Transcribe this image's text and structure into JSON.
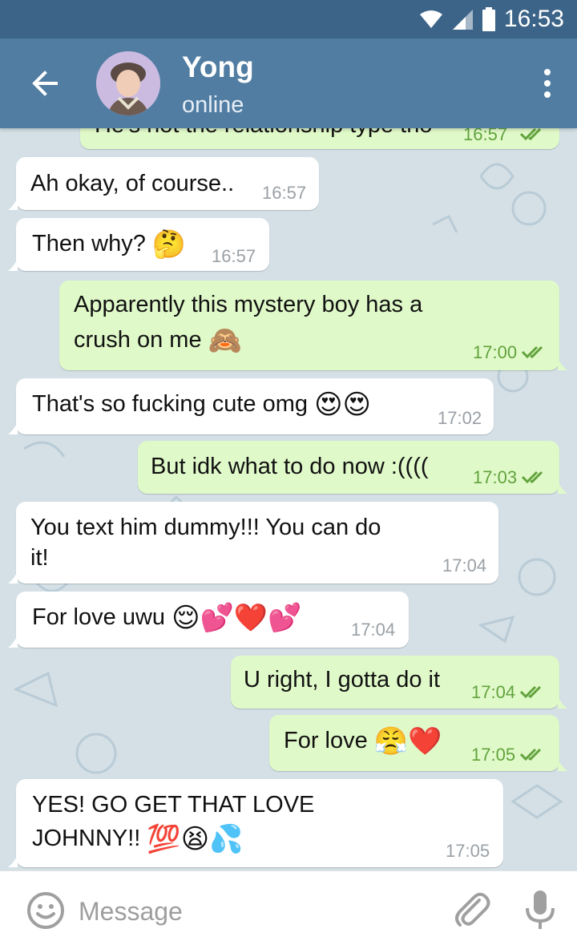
{
  "status_bar": {
    "time": "16:53"
  },
  "header": {
    "contact_name": "Yong",
    "contact_status": "online"
  },
  "messages": [
    {
      "dir": "out",
      "text": "He's not the relationship type tho",
      "time": "16:57",
      "read": true
    },
    {
      "dir": "in",
      "text": "Ah okay, of course..",
      "time": "16:57"
    },
    {
      "dir": "in",
      "text": "Then why?",
      "emoji": "🤔",
      "time": "16:57"
    },
    {
      "dir": "out",
      "line1": "Apparently this mystery boy has a",
      "line2": "crush on me",
      "emoji": "🙈",
      "time": "17:00",
      "read": true
    },
    {
      "dir": "in",
      "text": "That's so fucking cute omg",
      "emoji": "😍😍",
      "time": "17:02"
    },
    {
      "dir": "out",
      "text": "But idk what to do now :((((",
      "time": "17:03",
      "read": true
    },
    {
      "dir": "in",
      "line1": "You text him dummy!!! You can do",
      "line2": "it!",
      "time": "17:04"
    },
    {
      "dir": "in",
      "text": "For love uwu",
      "emoji": "😌💕❤️💕",
      "time": "17:04"
    },
    {
      "dir": "out",
      "text": "U right, I gotta do it",
      "time": "17:04",
      "read": true
    },
    {
      "dir": "out",
      "text": "For love",
      "emoji": "😤❤️",
      "time": "17:05",
      "read": true
    },
    {
      "dir": "in",
      "line1": "YES! GO GET THAT LOVE",
      "line2": "JOHNNY!!",
      "emoji": "💯😫💦",
      "time": "17:05"
    }
  ],
  "input": {
    "placeholder": "Message"
  },
  "icons": {
    "back": "arrow-left-icon",
    "menu": "more-vertical-icon",
    "emoji": "smiley-icon",
    "attach": "paperclip-icon",
    "mic": "microphone-icon",
    "read": "double-check-icon"
  },
  "colors": {
    "header": "#517da2",
    "status_bar": "#3c6488",
    "outgoing_bubble": "#e0f9c9",
    "incoming_bubble": "#ffffff",
    "chat_background": "#d4e0e6",
    "check_color": "#62a33d"
  }
}
